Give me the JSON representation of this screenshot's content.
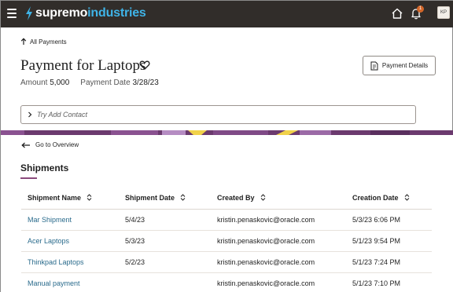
{
  "brand": {
    "part1": "supremo",
    "part2": "industries",
    "accent": "#3fb4e8"
  },
  "topbar": {
    "notification_count": "1",
    "avatar_initials": "KP"
  },
  "header": {
    "back_label": "All Payments",
    "title": "Payment for Laptops",
    "amount_label": "Amount",
    "amount_value": "5,000",
    "date_label": "Payment Date",
    "date_value": "3/28/23",
    "details_button": "Payment Details",
    "contact_placeholder": "Try Add Contact"
  },
  "overview_link": "Go to Overview",
  "shipments": {
    "title": "Shipments",
    "columns": [
      "Shipment Name",
      "Shipment Date",
      "Created By",
      "Creation Date"
    ],
    "rows": [
      {
        "name": "Mar Shipment",
        "date": "5/4/23",
        "created_by": "kristin.penaskovic@oracle.com",
        "creation_date": "5/3/23 6:06 PM"
      },
      {
        "name": "Acer Laptops",
        "date": "5/3/23",
        "created_by": "kristin.penaskovic@oracle.com",
        "creation_date": "5/1/23 9:54 PM"
      },
      {
        "name": "Thinkpad Laptops",
        "date": "5/2/23",
        "created_by": "kristin.penaskovic@oracle.com",
        "creation_date": "5/1/23 7:24 PM"
      },
      {
        "name": "Manual payment",
        "date": "",
        "created_by": "kristin.penaskovic@oracle.com",
        "creation_date": "5/1/23 7:10 PM"
      }
    ]
  }
}
